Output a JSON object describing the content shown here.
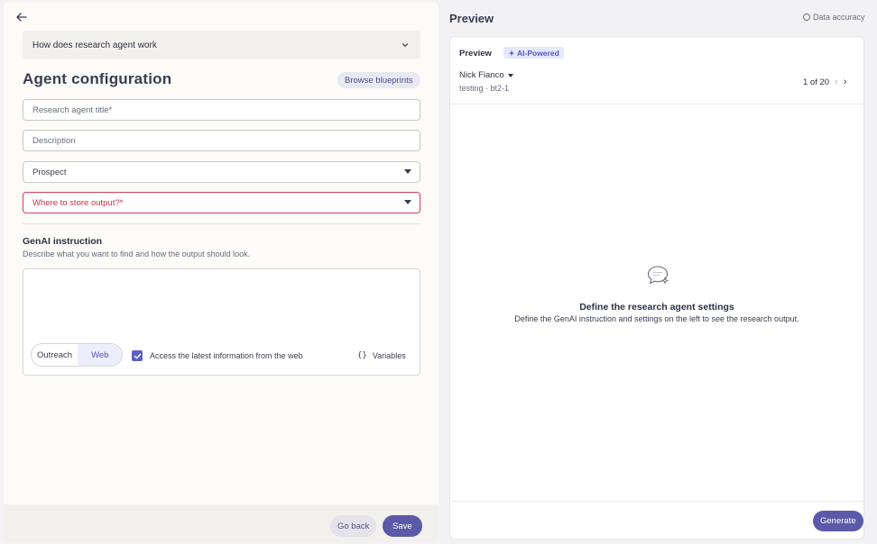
{
  "editor": {
    "back_label": "←",
    "how_works": "How does research agent work",
    "title": "Agent configuration",
    "browse_blueprints": "Browse blueprints",
    "fields": {
      "title_placeholder": "Research agent title*",
      "description_placeholder": "Description",
      "object_type": "Prospect",
      "output_placeholder": "Where to store output?*"
    },
    "genai": {
      "heading": "GenAI instruction",
      "subheading": "Describe what you want to find and how the output should look.",
      "toggle_outreach": "Outreach",
      "toggle_web": "Web",
      "web_access_label": "Access the latest information from the web",
      "web_access_checked": true,
      "variables_icon": "{}",
      "variables_label": "Variables"
    },
    "footer": {
      "go_back": "Go back",
      "save": "Save"
    }
  },
  "preview": {
    "heading": "Preview",
    "data_accuracy": "Data accuracy",
    "card_title": "Preview",
    "ai_badge": "AI-Powered",
    "person_name": "Nick Fianco",
    "sub_line": "testing · bt2-1",
    "pager_text": "1 of 20",
    "empty_title": "Define the research agent settings",
    "empty_subtitle": "Define the GenAI instruction and settings on the left to see the research output.",
    "generate": "Generate"
  },
  "colors": {
    "accent": "#5b5aa8",
    "error": "#d33c5b",
    "badge_bg": "#e6e8fb"
  },
  "icons": [
    "back-arrow-icon",
    "chevron-down-icon",
    "caret-down-icon",
    "check-icon",
    "braces-icon",
    "info-icon",
    "sparkle-icon",
    "chevron-left-icon",
    "chevron-right-icon",
    "chat-sparkle-icon"
  ]
}
